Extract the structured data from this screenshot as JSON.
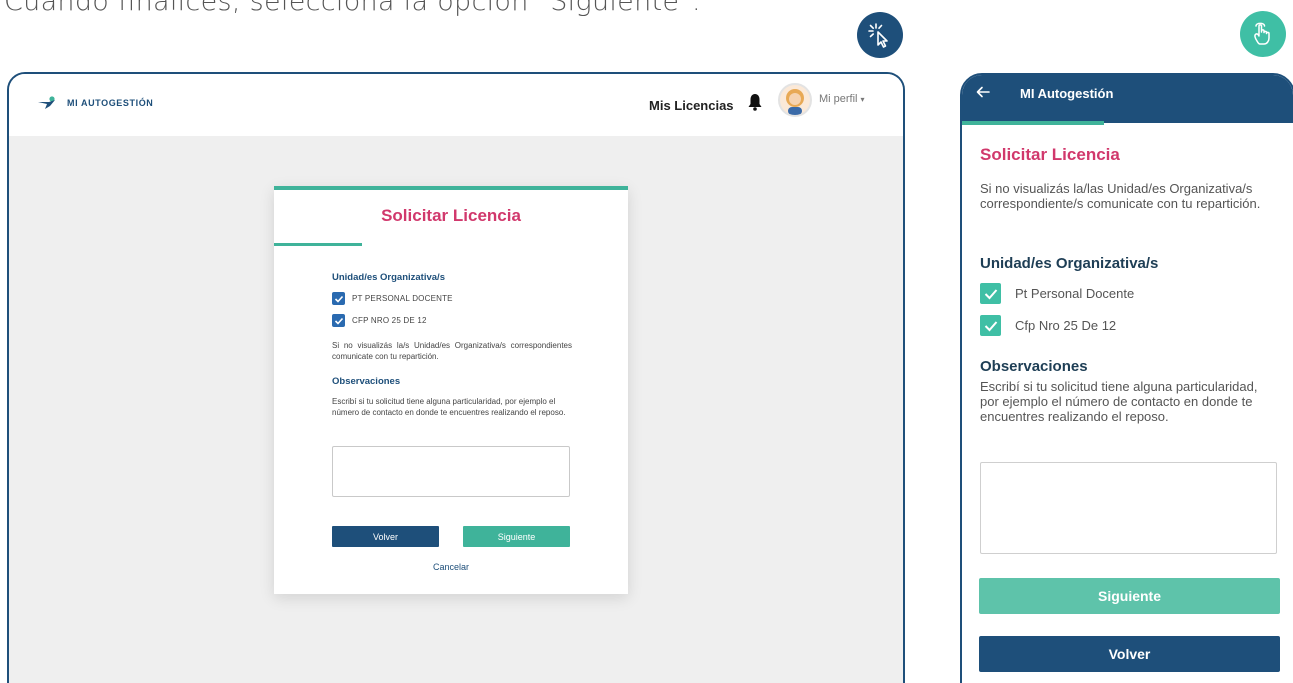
{
  "instruction": "Cuando finalices, seleccioná la opción \"Siguiente\".",
  "icons": {
    "click_badge": "click-pointer-icon",
    "touch_badge": "touch-hand-icon"
  },
  "colors": {
    "navy": "#1e4f7a",
    "teal": "#3fb39a",
    "pink": "#d1386c"
  },
  "desktop": {
    "header": {
      "logo_text": "MI AUTOGESTIÓN",
      "nav_link": "Mis Licencias",
      "profile_label": "Mi perfil"
    },
    "card": {
      "title": "Solicitar Licencia",
      "units_title": "Unidad/es Organizativa/s",
      "units": [
        "PT PERSONAL DOCENTE",
        "CFP NRO 25 DE 12"
      ],
      "units_note": "Si no visualizás la/s Unidad/es Organizativa/s correspondientes comunicate con tu repartición.",
      "obs_title": "Observaciones",
      "obs_text": "Escribí si tu solicitud tiene alguna particularidad, por ejemplo el número de contacto en donde te encuentres realizando el reposo.",
      "btn_back": "Volver",
      "btn_next": "Siguiente",
      "cancel": "Cancelar"
    }
  },
  "mobile": {
    "header_title": "MI Autogestión",
    "title": "Solicitar Licencia",
    "intro": "Si no visualizás la/las Unidad/es Organizativa/s correspondiente/s comunicate con tu repartición.",
    "units_title": "Unidad/es Organizativa/s",
    "units": [
      "Pt Personal Docente",
      "Cfp Nro 25 De 12"
    ],
    "obs_title": "Observaciones",
    "obs_text": "Escribí si tu solicitud tiene alguna particularidad, por ejemplo el número de contacto en donde te encuentres realizando el reposo.",
    "btn_next": "Siguiente",
    "btn_back": "Volver"
  }
}
